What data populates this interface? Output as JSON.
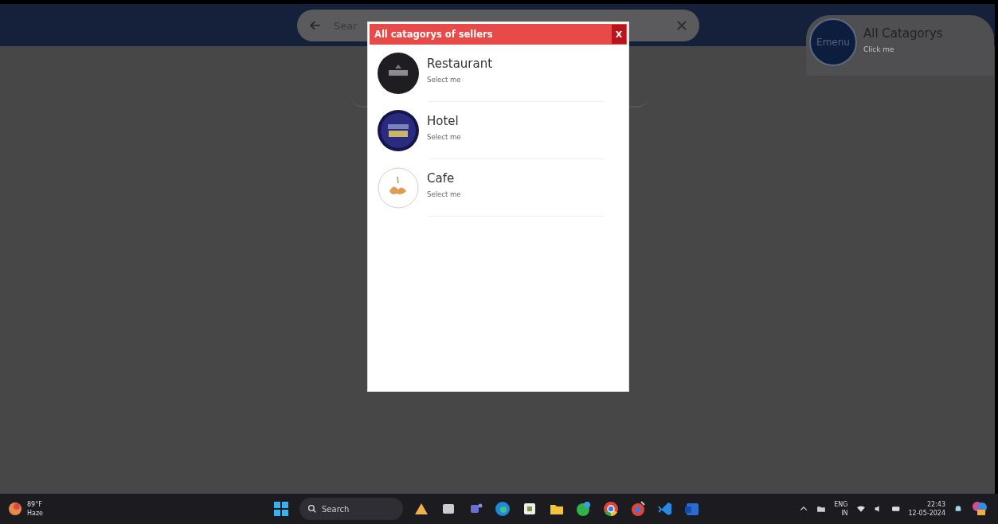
{
  "header": {
    "search": {
      "placeholder": "Sear"
    },
    "category_card": {
      "logo": "Emenu",
      "title": "All Catagorys",
      "subtitle": "Click me"
    }
  },
  "dialog": {
    "title": "All catagorys of sellers",
    "close": "X",
    "items": [
      {
        "name": "Restaurant",
        "hint": "Select me",
        "kind": "restaurant"
      },
      {
        "name": "Hotel",
        "hint": "Select me",
        "kind": "hotel"
      },
      {
        "name": "Cafe",
        "hint": "Select me",
        "kind": "cafe"
      }
    ]
  },
  "taskbar": {
    "weather": {
      "temp": "89°F",
      "condition": "Haze"
    },
    "search": "Search",
    "language": {
      "top": "ENG",
      "bottom": "IN"
    },
    "time": "22:43",
    "date": "12-05-2024"
  }
}
